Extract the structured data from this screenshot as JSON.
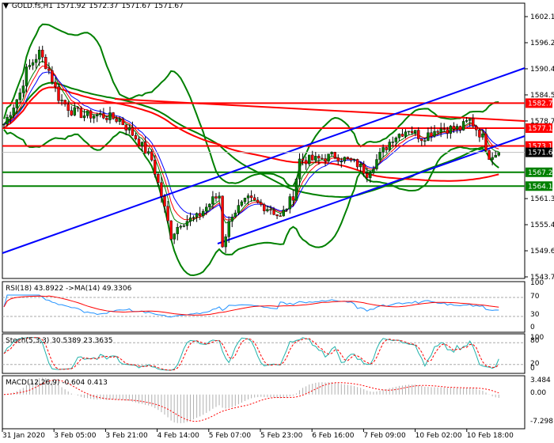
{
  "header": {
    "symbol": "GOLD.fs,H1",
    "open": "1571.92",
    "high": "1572.37",
    "low": "1571.67",
    "close": "1571.67"
  },
  "price_axis": [
    "1602.10",
    "1596.25",
    "1590.40",
    "1584.55",
    "1578.70",
    "1561.30",
    "1555.45",
    "1549.60",
    "1543.75"
  ],
  "levels": [
    {
      "label": "1582.70",
      "price": 1582.7,
      "color": "#ff0000"
    },
    {
      "label": "1577.10",
      "price": 1577.1,
      "color": "#ff0000"
    },
    {
      "label": "1573.10",
      "price": 1573.1,
      "color": "#ff0000"
    },
    {
      "label": "1567.20",
      "price": 1567.2,
      "color": "#008000"
    },
    {
      "label": "1564.10",
      "price": 1564.1,
      "color": "#008000"
    }
  ],
  "current_price": {
    "label": "1571.67",
    "price": 1571.67
  },
  "rsi": {
    "title": "RSI(18) 43.8922  ->MA(14) 49.3306",
    "axis": [
      "100",
      "70",
      "30",
      "0"
    ]
  },
  "stoch": {
    "title": "Stoch(5,3,3) 30.5389 23.3635",
    "axis": [
      "100",
      "80",
      "20",
      "0"
    ]
  },
  "macd": {
    "title": "MACD(12,26,9) -0.604 0.413",
    "axis": [
      "3.484",
      "0.00",
      "-7.298"
    ]
  },
  "time_axis": [
    "31 Jan 2020",
    "3 Feb 05:00",
    "3 Feb 21:00",
    "4 Feb 14:00",
    "5 Feb 07:00",
    "5 Feb 23:00",
    "6 Feb 16:00",
    "7 Feb 09:00",
    "10 Feb 02:00",
    "10 Feb 18:00"
  ],
  "chart_data": {
    "type": "candlestick",
    "price_range": [
      1543.75,
      1602.1
    ],
    "close_knots": [
      [
        0,
        1578
      ],
      [
        5,
        1585
      ],
      [
        7,
        1590
      ],
      [
        11,
        1594
      ],
      [
        14,
        1590
      ],
      [
        17,
        1584
      ],
      [
        21,
        1581
      ],
      [
        25,
        1580
      ],
      [
        30,
        1580
      ],
      [
        36,
        1579
      ],
      [
        41,
        1575
      ],
      [
        46,
        1570
      ],
      [
        49,
        1562
      ],
      [
        52,
        1553
      ],
      [
        55,
        1556
      ],
      [
        60,
        1557
      ],
      [
        65,
        1561
      ],
      [
        67,
        1562
      ],
      [
        68,
        1551
      ],
      [
        71,
        1558
      ],
      [
        76,
        1561
      ],
      [
        83,
        1559
      ],
      [
        86,
        1557
      ],
      [
        90,
        1562
      ],
      [
        92,
        1570
      ],
      [
        97,
        1570
      ],
      [
        103,
        1571
      ],
      [
        110,
        1569
      ],
      [
        113,
        1567
      ],
      [
        117,
        1571
      ],
      [
        121,
        1575
      ],
      [
        126,
        1577
      ],
      [
        130,
        1575
      ],
      [
        135,
        1577
      ],
      [
        142,
        1577
      ],
      [
        145,
        1579
      ],
      [
        149,
        1575
      ],
      [
        151,
        1571
      ],
      [
        154,
        1571.67
      ]
    ]
  },
  "colors": {
    "bull": "#008000",
    "bear": "#ff0000",
    "trend": "#0000ff",
    "band": "#008000"
  }
}
